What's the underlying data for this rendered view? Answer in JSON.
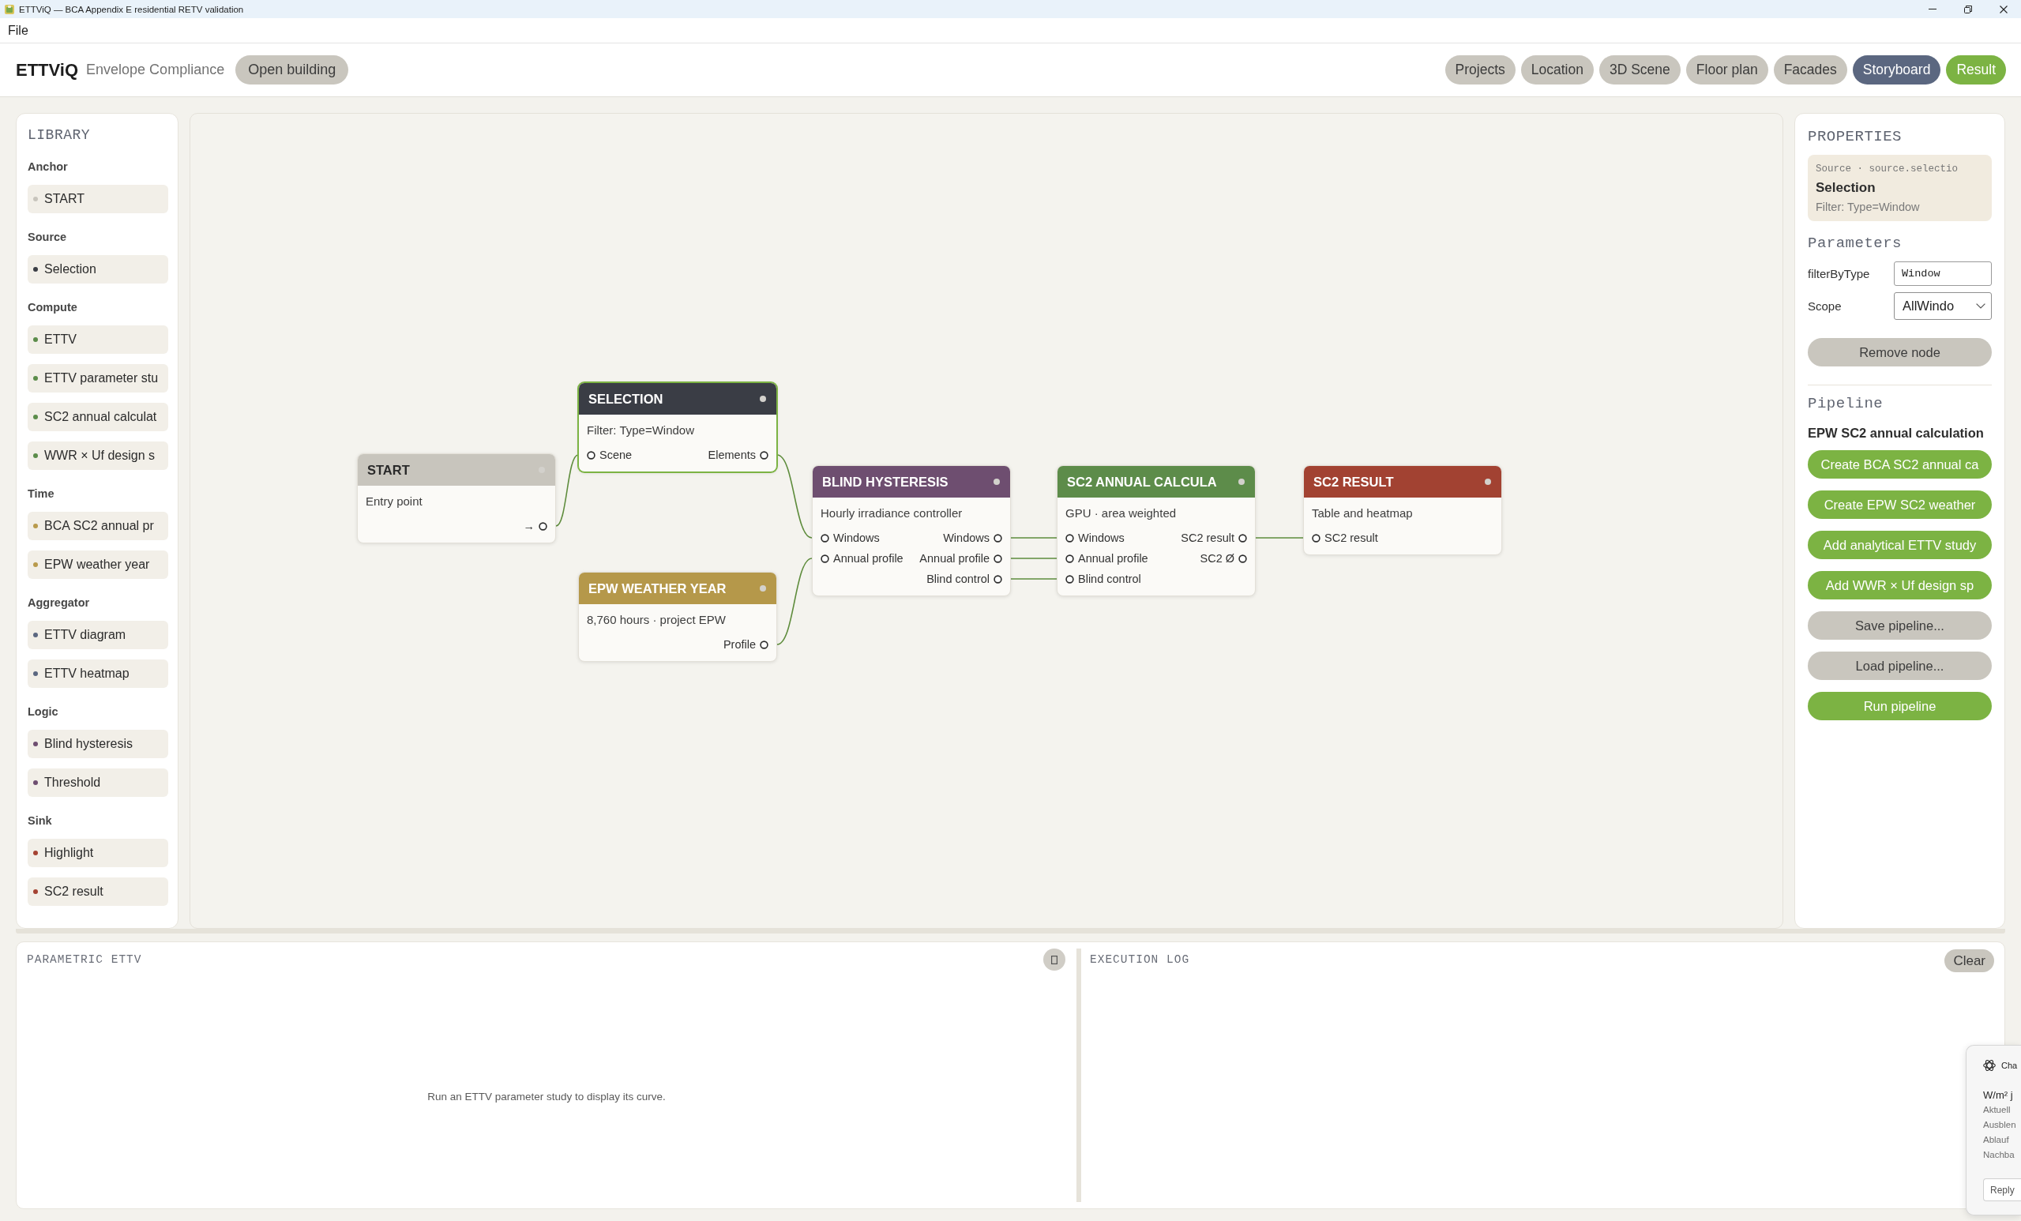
{
  "window": {
    "title": "ETTViQ — BCA Appendix E residential RETV validation"
  },
  "menu": [
    {
      "label": "File"
    }
  ],
  "header": {
    "app_name": "ETTViQ",
    "subtitle": "Envelope Compliance",
    "open_button": "Open building",
    "tabs": [
      {
        "label": "Projects",
        "selected": false,
        "kind": "tab"
      },
      {
        "label": "Location",
        "selected": false,
        "kind": "tab"
      },
      {
        "label": "3D Scene",
        "selected": false,
        "kind": "tab"
      },
      {
        "label": "Floor plan",
        "selected": false,
        "kind": "tab"
      },
      {
        "label": "Facades",
        "selected": false,
        "kind": "tab"
      },
      {
        "label": "Storyboard",
        "selected": true,
        "kind": "tab"
      },
      {
        "label": "Result",
        "selected": false,
        "kind": "accent"
      }
    ]
  },
  "library": {
    "title": "LIBRARY",
    "groups": [
      {
        "name": "Anchor",
        "items": [
          {
            "label": "START",
            "color": "#c8c5bd"
          }
        ]
      },
      {
        "name": "Source",
        "items": [
          {
            "label": "Selection",
            "color": "#3a3d45"
          }
        ]
      },
      {
        "name": "Compute",
        "items": [
          {
            "label": "ETTV",
            "color": "#5b8c4a"
          },
          {
            "label": "ETTV parameter stu",
            "color": "#5b8c4a"
          },
          {
            "label": "SC2 annual calculat",
            "color": "#5b8c4a"
          },
          {
            "label": "WWR × Uf design s",
            "color": "#5b8c4a"
          }
        ]
      },
      {
        "name": "Time",
        "items": [
          {
            "label": "BCA SC2 annual pr",
            "color": "#b89a4c"
          },
          {
            "label": "EPW weather year",
            "color": "#b89a4c"
          }
        ]
      },
      {
        "name": "Aggregator",
        "items": [
          {
            "label": "ETTV diagram",
            "color": "#5b6780"
          },
          {
            "label": "ETTV heatmap",
            "color": "#5b6780"
          }
        ]
      },
      {
        "name": "Logic",
        "items": [
          {
            "label": "Blind hysteresis",
            "color": "#6e4e70"
          },
          {
            "label": "Threshold",
            "color": "#6e4e70"
          }
        ]
      },
      {
        "name": "Sink",
        "items": [
          {
            "label": "Highlight",
            "color": "#a44232"
          },
          {
            "label": "SC2 result",
            "color": "#a44232"
          }
        ]
      }
    ]
  },
  "canvas": {
    "nodes": [
      {
        "title": "START",
        "color": "#c8c5bd",
        "selected": false,
        "description": "Entry point",
        "ports": [
          {
            "out": "→"
          }
        ]
      },
      {
        "title": "SELECTION",
        "color": "#3a3d45",
        "selected": true,
        "description": "Filter: Type=Window",
        "ports": [
          {
            "in": "Scene",
            "out": "Elements"
          }
        ]
      },
      {
        "title": "EPW WEATHER YEAR",
        "color": "#b5984a",
        "selected": false,
        "description": "8,760 hours · project EPW",
        "ports": [
          {
            "out": "Profile"
          }
        ]
      },
      {
        "title": "BLIND HYSTERESIS",
        "color": "#6e4e70",
        "selected": false,
        "description": "Hourly irradiance controller",
        "ports": [
          {
            "in": "Windows",
            "out": "Windows"
          },
          {
            "in": "Annual profile",
            "out": "Annual profile"
          },
          {
            "out": "Blind control"
          }
        ]
      },
      {
        "title": "SC2 ANNUAL CALCULA",
        "color": "#5d8c4a",
        "selected": false,
        "description": "GPU · area weighted",
        "ports": [
          {
            "in": "Windows",
            "out": "SC2 result"
          },
          {
            "in": "Annual profile",
            "out": "SC2 Ø"
          },
          {
            "in": "Blind control"
          }
        ]
      },
      {
        "title": "SC2 RESULT",
        "color": "#a24232",
        "selected": false,
        "description": "Table and heatmap",
        "ports": [
          {
            "in": "SC2 result"
          }
        ]
      }
    ]
  },
  "properties": {
    "title": "PROPERTIES",
    "summary": {
      "type_line": "Source · source.selectio",
      "name": "Selection",
      "detail": "Filter: Type=Window"
    },
    "parameters_title": "Parameters",
    "fields": [
      {
        "label": "filterByType",
        "kind": "text",
        "value": "Window"
      },
      {
        "label": "Scope",
        "kind": "select",
        "value": "AllWindo"
      }
    ],
    "remove_button": "Remove node",
    "pipeline_title": "Pipeline",
    "pipeline_name": "EPW SC2 annual calculation",
    "buttons": [
      {
        "label": "Create BCA SC2 annual ca",
        "kind": "primary"
      },
      {
        "label": "Create EPW SC2 weather",
        "kind": "primary"
      },
      {
        "label": "Add analytical ETTV study",
        "kind": "primary"
      },
      {
        "label": "Add WWR × Uf design sp",
        "kind": "primary"
      },
      {
        "label": "Save pipeline...",
        "kind": "secondary"
      },
      {
        "label": "Load pipeline...",
        "kind": "secondary"
      },
      {
        "label": "Run pipeline",
        "kind": "primary"
      }
    ]
  },
  "bottom": {
    "chart_pane": {
      "title": "PARAMETRIC ETTV",
      "message": "Run an ETTV parameter study to display its curve."
    },
    "log_pane": {
      "title": "EXECUTION LOG",
      "clear_button": "Clear"
    }
  },
  "notification": {
    "app": "Cha",
    "heading": "W/m² j",
    "lines": [
      "Aktuell",
      "Ausblen",
      "Ablauf",
      "Nachba"
    ],
    "reply_button": "Reply"
  }
}
